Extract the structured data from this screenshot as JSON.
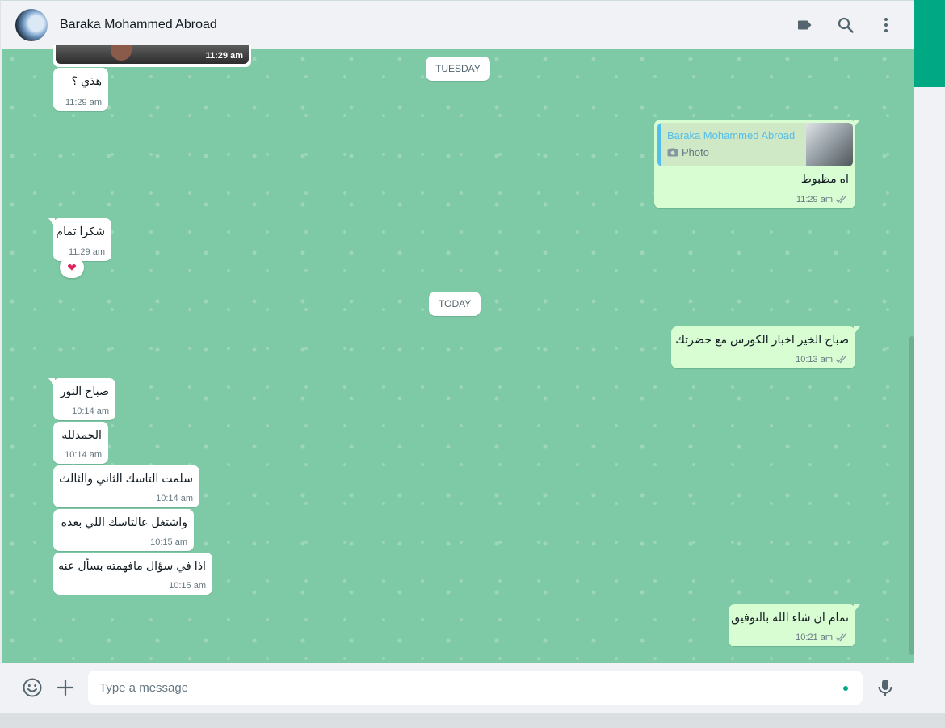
{
  "colors": {
    "accent": "#00a884",
    "chat_bg": "#7ec9a6",
    "outgoing": "#d9fdd3",
    "incoming": "#ffffff",
    "quote_name": "#53bdeb"
  },
  "header": {
    "contact_name": "Baraka Mohammed Abroad",
    "icons": [
      "label-icon",
      "search-icon",
      "menu-dots-icon"
    ]
  },
  "date_dividers": {
    "tuesday": "TUESDAY",
    "today": "TODAY"
  },
  "messages": [
    {
      "dir": "in",
      "type": "image",
      "time": "11:29 am"
    },
    {
      "dir": "in",
      "text": "هذي ؟",
      "time": "11:29 am"
    },
    {
      "dir": "out",
      "quote": {
        "sender": "Baraka Mohammed Abroad",
        "type": "Photo"
      },
      "text": "اه مظبوط",
      "time": "11:29 am",
      "status": "read"
    },
    {
      "dir": "in",
      "text": "شكرا تمام",
      "time": "11:29 am",
      "reaction": "❤"
    },
    {
      "dir": "out",
      "text": "صباح الخير  اخبار الكورس مع حضرتك",
      "time": "10:13 am",
      "status": "read"
    },
    {
      "dir": "in",
      "text": "صباح النور",
      "time": "10:14 am"
    },
    {
      "dir": "in",
      "text": "الحمدلله",
      "time": "10:14 am"
    },
    {
      "dir": "in",
      "text": "سلمت التاسك الثاني والثالث",
      "time": "10:14 am"
    },
    {
      "dir": "in",
      "text": "واشتغل عالتاسك اللي بعده",
      "time": "10:15 am"
    },
    {
      "dir": "in",
      "text": "اذا في سؤال مافهمته بسأل عنه",
      "time": "10:15 am"
    },
    {
      "dir": "out",
      "text": "تمام ان شاء الله بالتوفيق",
      "time": "10:21 am",
      "status": "read"
    }
  ],
  "composer": {
    "placeholder": "Type a message",
    "value": "",
    "icons": [
      "emoji-icon",
      "attach-plus-icon",
      "microphone-icon"
    ]
  }
}
